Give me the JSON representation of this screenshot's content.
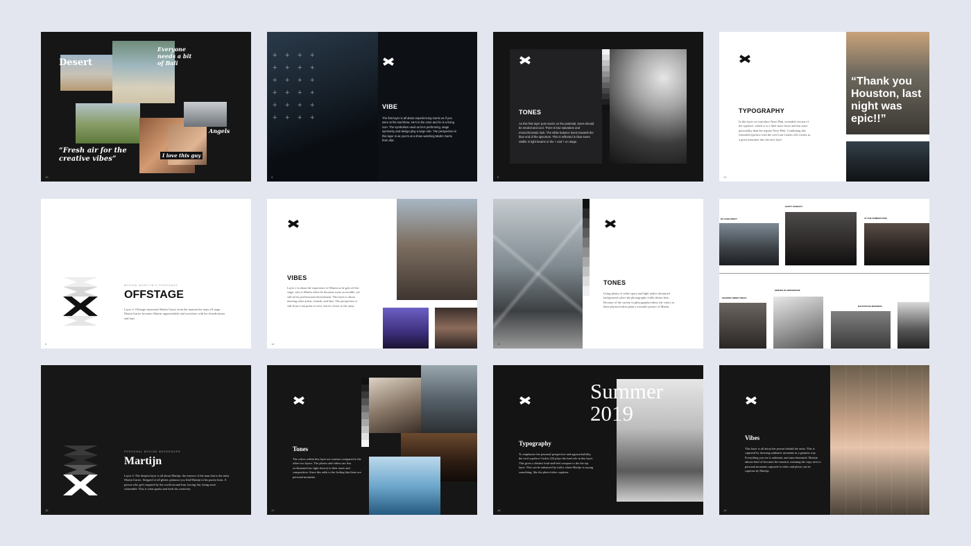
{
  "slides": {
    "s1": {
      "title": "Desert",
      "caption_bali": "Everyone needs a bit of Bali",
      "caption_angels": "Angels",
      "caption_fresh": "“Fresh air for the creative vibes”",
      "caption_love": "I love this guy",
      "page": "13"
    },
    "s2": {
      "title": "VIBE",
      "body": "The first layer is all about experiencing Garrix as if you were at his tour/show. He's in the zone and he is a living icon. The symbolism used as he's performing, stage symmetry and design play a large role. The perspective in this layer is as you're at a show watching Martin Garrix from afar.",
      "page": "4"
    },
    "s3": {
      "title": "TONES",
      "body": "As this first layer puts Garrix on the pedestal, tones should be neutral and cool. There is low saturation and monochromatic look. The white balance leans towards the blue end of the spectrum. This is reflected in blue tones visible in light beams or the + and × on stage.",
      "page": "5"
    },
    "s4": {
      "title": "TYPOGRAPHY",
      "body": "In this layer we introduce Neue Plak, extended version of the typeface, which is is a little more loose and has more personality than the regular Neue Plak. Combining this extended typeface with the serif font Caslon 224 creates as a great transition into the next layer",
      "quote": "“Thank you Houston, last night was epic!!”",
      "page": "12"
    },
    "s5": {
      "kicker": "BEHIND MARTIJN'S PERSONAS",
      "title": "OFFSTAGE",
      "body": "Layer 2: Offstage represents Martin Garrix from the moment he steps off stage. Martin Garrix becomes Martin, approachable and sociolises with his friends/artists and fans.",
      "page": "9"
    },
    "s6": {
      "title": "VIBES",
      "body": "Layer 2 is about the experience of Martin as he gets off the stage, who is Martin when he becomes more accessible, yet still in his professional environment. This layer is about meeting other artists, friends, and fans. The perspective is still from a fan point of view, but it's closer to the artist.",
      "page": "10"
    },
    "s7": {
      "title": "TONES",
      "body": "Using plenty of white space and light and/or desatured background colors the photography really shines here. Because of the variety in photographs/videos the colors in these photos/videos paint a versatile picture of Martin.",
      "page": "11"
    },
    "s8": {
      "cap1": "MY FANS DIDN'T",
      "cap2": "HAPPY SUNDAY!!",
      "cap3": "AT THE NUMBER KING",
      "cap4": "SHARING SWEET IDEAS",
      "cap5": "SERVED IN AMSTERDAM",
      "cap6": "BACKSTAGE MADNESS"
    },
    "s9": {
      "kicker": "PERSONAL BEHIND MESSENGER",
      "title": "Martijn",
      "body": "Layer 3: The deepest layer is all about Martijn, the essence of the man that is the artist Martin Garrix. Stripped of all glitter, glamour you find Martijn in his purest form. A person who get's inspired by the world around him, having fun, being more vulnerable. This is what sparks and fuels his creativity.",
      "page": "15"
    },
    "s10": {
      "title": "Tones",
      "body": "The colors within this layer are warmer compared to the other two layers. The photos and videos are less orchestrated (no light shows) in their tones and composition. Since this adds to the feeling that these are personal moments.",
      "page": "17"
    },
    "s11": {
      "big": "Summer 2019",
      "title": "Typography",
      "body": "To emphasize the personal perspective and approachability, the serif typeface Caslon 224 plays the lead role in this layer. This gives a distinct look-and-feel compare to the the top layer. This can be enhanced by italics when Martijn is saying something, like the photo/video captions.",
      "page": "18"
    },
    "s12": {
      "title": "Vibes",
      "body": "This layer is all about the person behind the artist. This is captured by showing authentic moments in a genuine way. Everything you see is authentic and unorchestrated. Martijn almost kind of becomes the narrator, meaning the copy next to personal moments captured in video and photo can be captions by Martijn.",
      "page": "19"
    }
  },
  "icons": [
    "x-logo",
    "plus-icon"
  ],
  "colors": {
    "background": "#e3e6ee",
    "dark_slide": "#161616",
    "white_slide": "#ffffff"
  }
}
